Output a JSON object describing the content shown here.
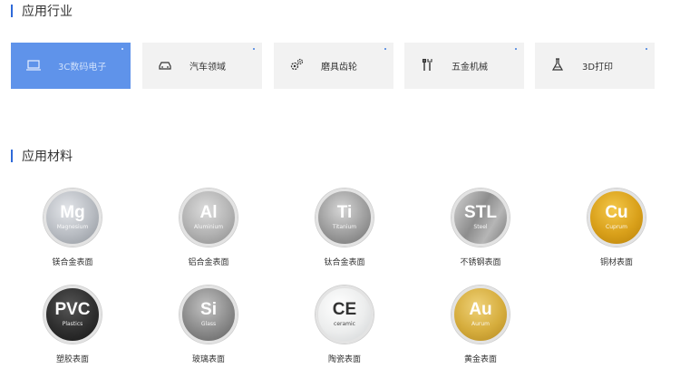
{
  "sections": {
    "industry_title": "应用行业",
    "material_title": "应用材料"
  },
  "industries": [
    {
      "label": "3C数码电子",
      "icon": "laptop-icon",
      "active": true
    },
    {
      "label": "汽车领域",
      "icon": "car-icon",
      "active": false
    },
    {
      "label": "磨具齿轮",
      "icon": "gears-icon",
      "active": false
    },
    {
      "label": "五金机械",
      "icon": "tools-icon",
      "active": false
    },
    {
      "label": "3D打印",
      "icon": "flask-icon",
      "active": false
    }
  ],
  "materials": [
    {
      "symbol": "Mg",
      "sub": "Magnesium",
      "name": "镁合金表面",
      "style": "g-mg"
    },
    {
      "symbol": "Al",
      "sub": "Aluminium",
      "name": "铝合金表面",
      "style": "g-al"
    },
    {
      "symbol": "Ti",
      "sub": "Titanium",
      "name": "钛合金表面",
      "style": "g-ti"
    },
    {
      "symbol": "STL",
      "sub": "Steel",
      "name": "不锈钢表面",
      "style": "g-stl"
    },
    {
      "symbol": "Cu",
      "sub": "Cuprum",
      "name": "铜材表面",
      "style": "g-cu"
    },
    {
      "symbol": "PVC",
      "sub": "Plastics",
      "name": "塑胶表面",
      "style": "g-pvc"
    },
    {
      "symbol": "Si",
      "sub": "Glass",
      "name": "玻璃表面",
      "style": "g-si"
    },
    {
      "symbol": "CE",
      "sub": "ceramic",
      "name": "陶瓷表面",
      "style": "g-ce"
    },
    {
      "symbol": "Au",
      "sub": "Aurum",
      "name": "黄金表面",
      "style": "g-au"
    }
  ],
  "colors": {
    "accent": "#2f6ad9",
    "active_card": "#5f93ea",
    "card_bg": "#f2f2f2"
  }
}
